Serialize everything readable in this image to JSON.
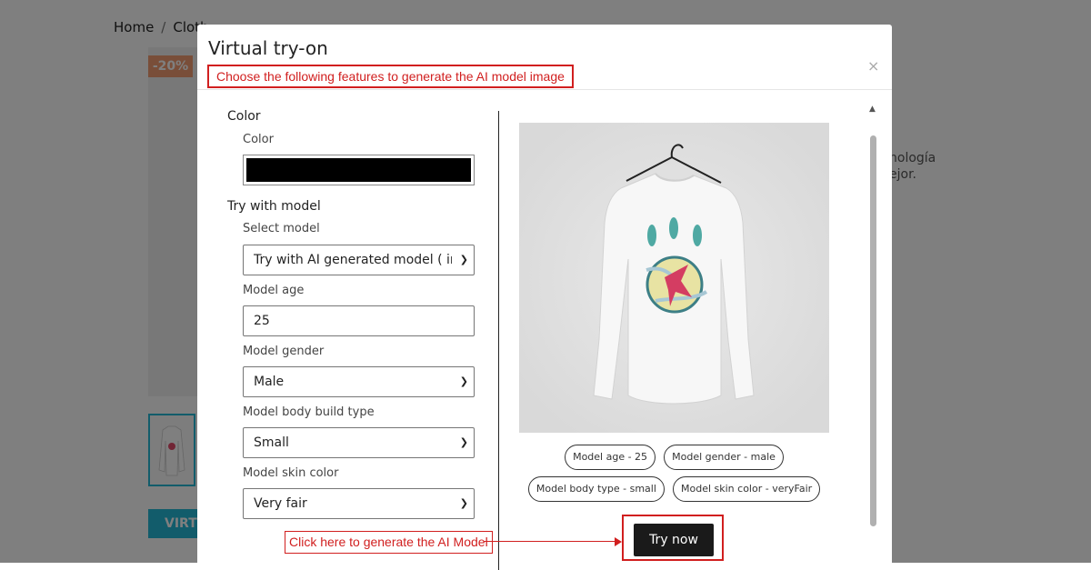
{
  "background": {
    "breadcrumb": {
      "home": "Home",
      "separator": "/",
      "current": "Cloth"
    },
    "discount_badge": "-20%",
    "virtual_button_label": "VIRTU",
    "desc_line1": "nología",
    "desc_line2": "ejor."
  },
  "modal": {
    "title": "Virtual try-on",
    "subtitle": "Choose the following features to generate the AI model image",
    "close": "×",
    "color_section": {
      "title": "Color",
      "field_label": "Color",
      "selected_color": "#000000"
    },
    "model_section": {
      "title": "Try with model",
      "select_model_label": "Select model",
      "select_model_value": "Try with AI generated model ( ima",
      "age_label": "Model age",
      "age_value": "25",
      "gender_label": "Model gender",
      "gender_value": "Male",
      "body_label": "Model body build type",
      "body_value": "Small",
      "skin_label": "Model skin color",
      "skin_value": "Very fair"
    },
    "chips": [
      "Model age - 25",
      "Model gender - male",
      "Model body type - small",
      "Model skin color - veryFair"
    ],
    "try_now": "Try now",
    "annotation": "Click here to generate the AI Model"
  }
}
